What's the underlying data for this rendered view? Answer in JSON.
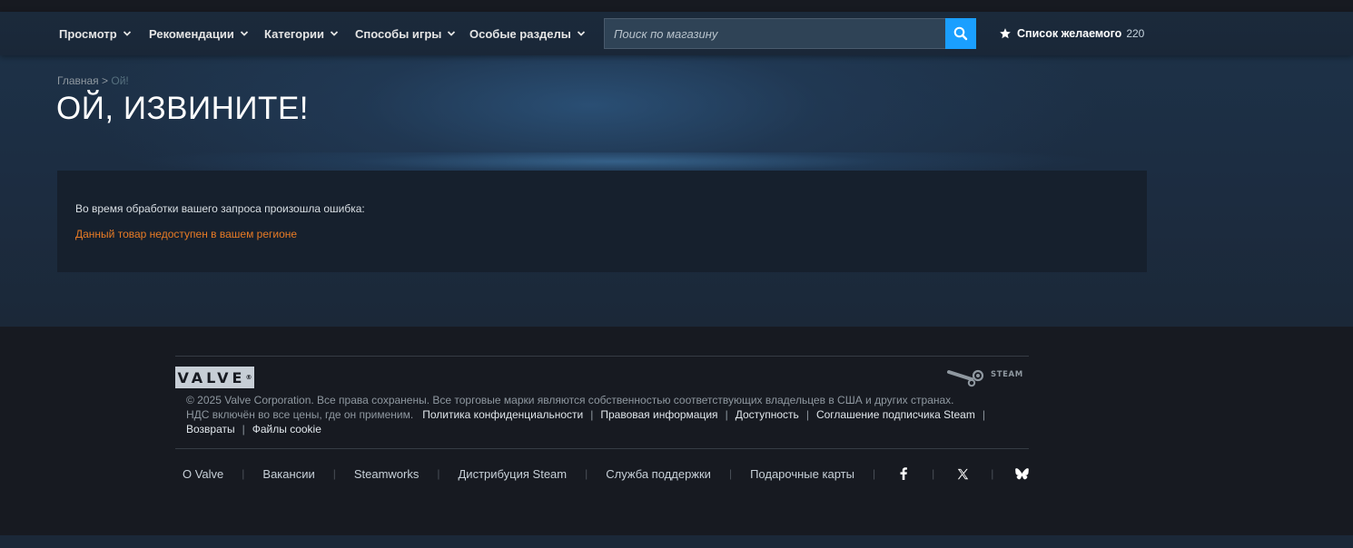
{
  "nav": {
    "items": [
      {
        "label": "Просмотр"
      },
      {
        "label": "Рекомендации"
      },
      {
        "label": "Категории"
      },
      {
        "label": "Способы игры"
      },
      {
        "label": "Особые разделы"
      }
    ],
    "search_placeholder": "Поиск по магазину",
    "wishlist_label": "Список желаемого",
    "wishlist_count": "220"
  },
  "breadcrumb": {
    "home": "Главная",
    "separator": ">",
    "current": "Ой!"
  },
  "page": {
    "title": "ОЙ, ИЗВИНИТЕ!",
    "error_intro": "Во время обработки вашего запроса произошла ошибка:",
    "error_message": "Данный товар недоступен в вашем регионе"
  },
  "footer": {
    "valve_logo_text": "VALVE",
    "steam_logo_text": "STEAM",
    "copyright": "© 2025 Valve Corporation. Все права сохранены. Все торговые марки являются собственностью соответствующих владельцев в США и других странах.",
    "vat_note": "НДС включён во все цены, где он применим.",
    "legal_links": [
      "Политика конфиденциальности",
      "Правовая информация",
      "Доступность",
      "Соглашение подписчика Steam",
      "Возвраты",
      "Файлы cookie"
    ],
    "links": [
      "О Valve",
      "Вакансии",
      "Steamworks",
      "Дистрибуция Steam",
      "Служба поддержки",
      "Подарочные карты"
    ],
    "social_icons": [
      "facebook-icon",
      "x-icon",
      "bluesky-icon"
    ]
  },
  "colors": {
    "accent_blue": "#1a9fff",
    "error_orange": "#e87b25",
    "background": "#1b2838",
    "footer_bg": "#171a21"
  }
}
